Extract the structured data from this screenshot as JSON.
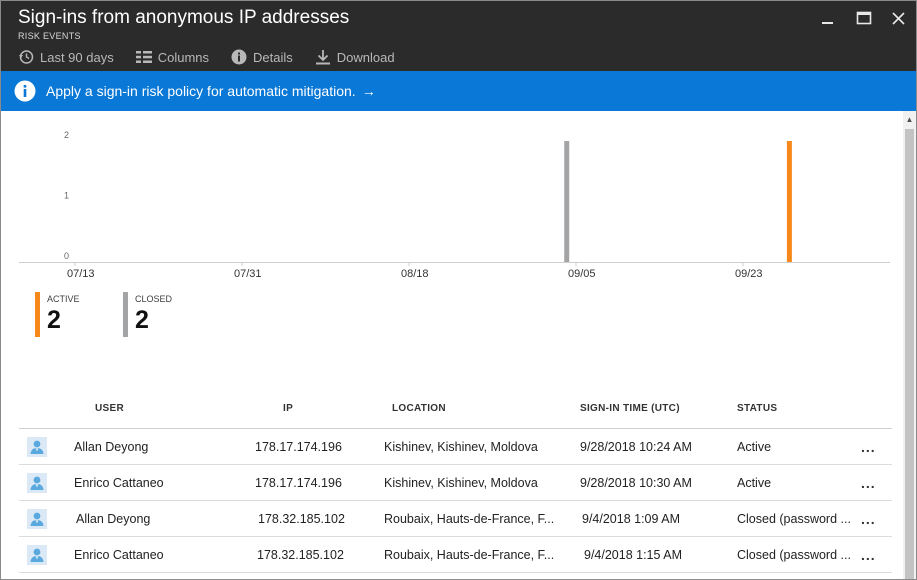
{
  "header": {
    "title": "Sign-ins from anonymous IP addresses",
    "subtitle": "RISK EVENTS"
  },
  "toolbar": {
    "items": [
      {
        "label": "Last 90 days",
        "icon": "history-icon"
      },
      {
        "label": "Columns",
        "icon": "columns-icon"
      },
      {
        "label": "Details",
        "icon": "info-icon"
      },
      {
        "label": "Download",
        "icon": "download-icon"
      }
    ]
  },
  "banner": {
    "text": "Apply a sign-in risk policy for automatic mitigation.",
    "arrow": "→",
    "color": "#0a78d6"
  },
  "chart_data": {
    "type": "bar",
    "x_ticks": [
      "07/13",
      "07/31",
      "08/18",
      "09/05",
      "09/23"
    ],
    "y_ticks": [
      "0",
      "1",
      "2"
    ],
    "ylim": [
      0,
      2
    ],
    "grid": false,
    "series": [
      {
        "name": "CLOSED",
        "color": "#a2a4a6",
        "points": [
          {
            "x": "09/04",
            "y": 2
          }
        ]
      },
      {
        "name": "ACTIVE",
        "color": "#f7891c",
        "points": [
          {
            "x": "09/28",
            "y": 2
          }
        ]
      }
    ]
  },
  "summary": {
    "active": {
      "label": "ACTIVE",
      "value": "2",
      "color": "#f7891c"
    },
    "closed": {
      "label": "CLOSED",
      "value": "2",
      "color": "#a2a4a6"
    }
  },
  "table": {
    "columns": {
      "user": "USER",
      "ip": "IP",
      "location": "LOCATION",
      "time": "SIGN-IN TIME (UTC)",
      "status": "STATUS"
    },
    "rows": [
      {
        "user": "Allan Deyong",
        "ip": "178.17.174.196",
        "location": "Kishinev, Kishinev, Moldova",
        "time": "9/28/2018 10:24 AM",
        "status": "Active",
        "more": "..."
      },
      {
        "user": "Enrico Cattaneo",
        "ip": "178.17.174.196",
        "location": "Kishinev, Kishinev, Moldova",
        "time": "9/28/2018 10:30 AM",
        "status": "Active",
        "more": "..."
      },
      {
        "user": "Allan Deyong",
        "ip": "178.32.185.102",
        "location": "Roubaix, Hauts-de-France, F...",
        "time": "9/4/2018 1:09 AM",
        "status": "Closed (password ...",
        "more": "..."
      },
      {
        "user": "Enrico Cattaneo",
        "ip": "178.32.185.102",
        "location": "Roubaix, Hauts-de-France, F...",
        "time": "9/4/2018 1:15 AM",
        "status": "Closed (password ...",
        "more": "..."
      }
    ]
  }
}
